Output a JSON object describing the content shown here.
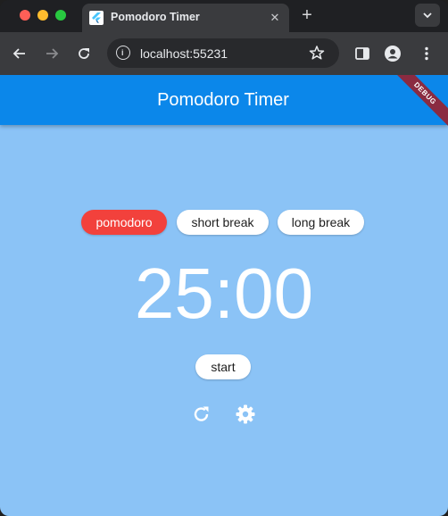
{
  "browser": {
    "tab": {
      "title": "Pomodoro Timer",
      "close_glyph": "✕"
    },
    "new_tab_glyph": "+",
    "address": {
      "url": "localhost:55231"
    },
    "icons": [
      "back-icon",
      "forward-icon",
      "reload-icon",
      "info-icon",
      "star-icon",
      "sidebar-icon",
      "profile-icon",
      "menu-icon",
      "chevron-down-icon"
    ]
  },
  "app": {
    "title": "Pomodoro Timer",
    "debug_banner": "DEBUG",
    "modes": [
      {
        "label": "pomodoro",
        "active": true
      },
      {
        "label": "short break",
        "active": false
      },
      {
        "label": "long break",
        "active": false
      }
    ],
    "timer": "25:00",
    "start_label": "start",
    "actions": [
      "reset-icon",
      "settings-icon"
    ],
    "colors": {
      "appbar": "#0b87ea",
      "background": "#8bc3f6",
      "active_mode": "#f2413c",
      "debug_banner": "#8a2b41"
    }
  }
}
